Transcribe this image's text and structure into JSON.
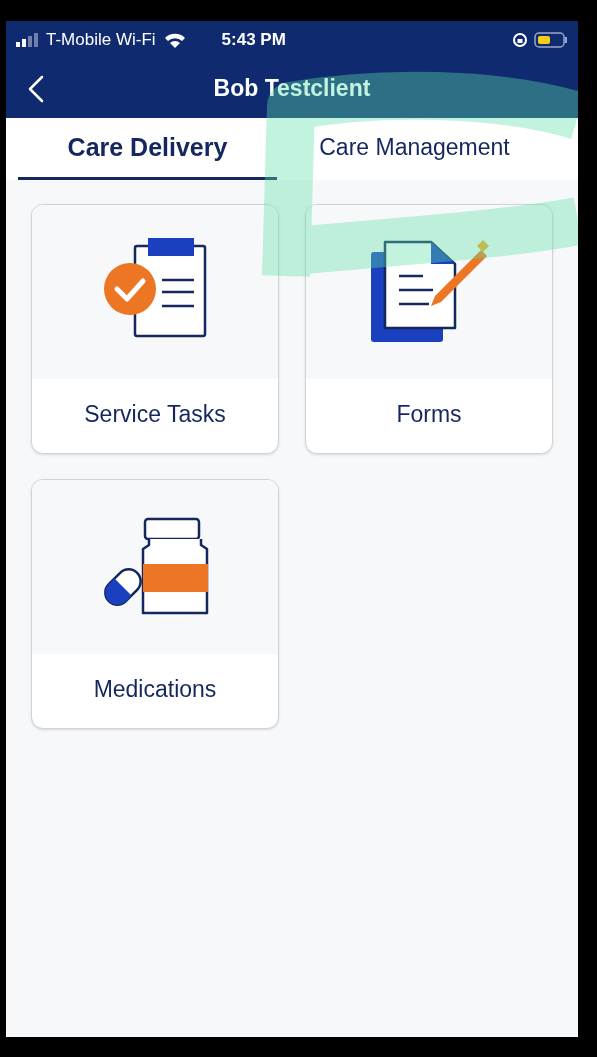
{
  "status_bar": {
    "carrier": "T-Mobile Wi-Fi",
    "time": "5:43 PM"
  },
  "header": {
    "title": "Bob Testclient"
  },
  "tabs": [
    {
      "label": "Care Delivery",
      "selected": true
    },
    {
      "label": "Care Management",
      "selected": false
    }
  ],
  "tiles": [
    {
      "kind": "tasks",
      "label": "Service Tasks"
    },
    {
      "kind": "forms",
      "label": "Forms"
    },
    {
      "kind": "medications",
      "label": "Medications"
    }
  ]
}
